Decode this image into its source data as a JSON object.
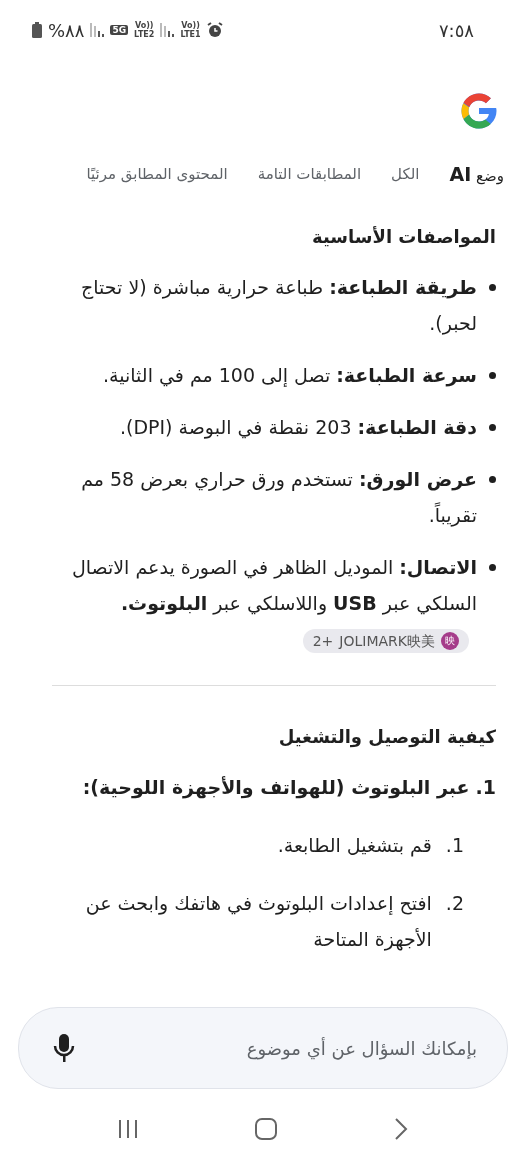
{
  "status_bar": {
    "time": "٧:٥٨",
    "battery": "%٨٨",
    "sims": [
      {
        "voice": "Vo))",
        "line": "LTE1"
      },
      {
        "network": "5G",
        "voice": "Vo))",
        "line": "LTE2"
      }
    ]
  },
  "tabs": [
    {
      "label": "وضع **AI**",
      "selected": true
    },
    {
      "label": "الكل",
      "selected": false
    },
    {
      "label": "المطابقات التامة",
      "selected": false
    },
    {
      "label": "المحتوى المطابق مرئيًا",
      "selected": false
    }
  ],
  "sections": [
    {
      "heading": "المواصفات الأساسية",
      "kind": "bullets",
      "items": [
        {
          "text": "**طريقة الطباعة:** طباعة حرارية مباشرة (لا تحتاج لحبر)."
        },
        {
          "text": "**سرعة الطباعة:** تصل إلى 100 مم في الثانية."
        },
        {
          "text": "**دقة الطباعة:** 203 نقطة في البوصة (DPI)."
        },
        {
          "text": "**عرض الورق:** تستخدم ورق حراري بعرض 58 مم تقريباً."
        },
        {
          "text": "**الاتصال:** الموديل الظاهر في الصورة يدعم الاتصال السلكي عبر **USB** واللاسلكي عبر **البلوتوث.**",
          "source": {
            "more": "2+",
            "label": "JOLIMARK映美",
            "badge": "映"
          }
        }
      ]
    },
    {
      "heading": "كيفية التوصيل والتشغيل",
      "kind": "steps",
      "items": [
        {
          "number": "1.",
          "text": "عبر البلوتوث (للهواتف والأجهزة اللوحية):",
          "children": [
            {
              "number": "1.",
              "text": "قم بتشغيل الطابعة."
            },
            {
              "number": "2.",
              "text": "افتح إعدادات البلوتوث في هاتفك وابحث عن الأجهزة المتاحة"
            }
          ]
        }
      ]
    }
  ],
  "search": {
    "placeholder": "بإمكانك السؤال عن أي موضوع"
  }
}
